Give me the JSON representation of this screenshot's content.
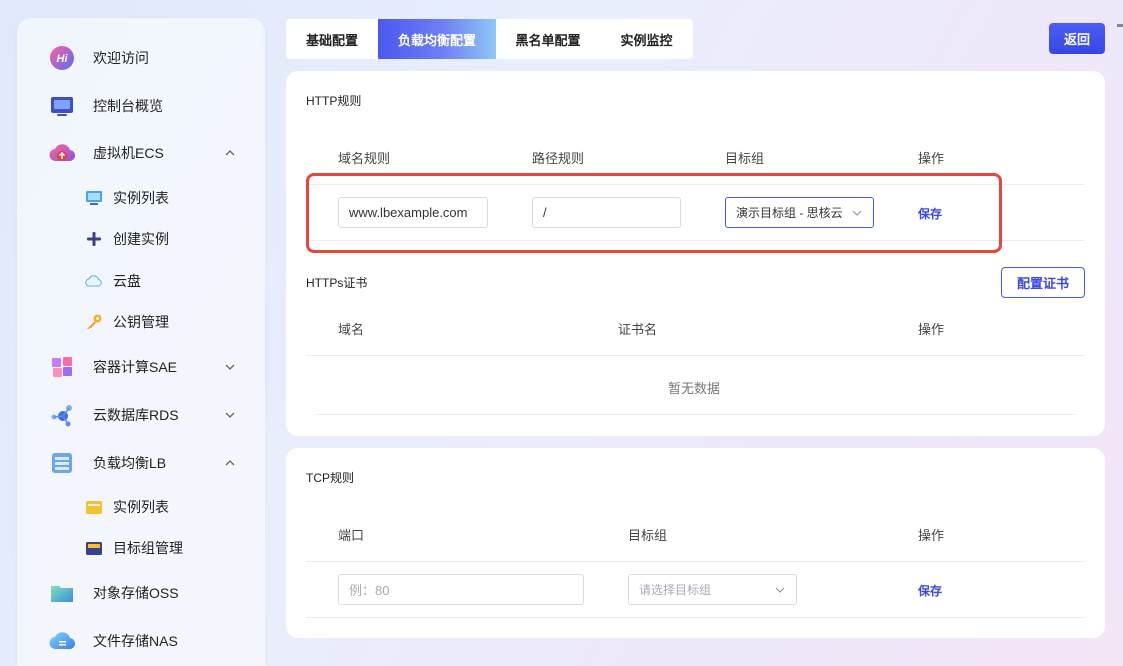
{
  "sidebar": {
    "items": [
      {
        "label": "欢迎访问",
        "icon": "hi-logo-icon"
      },
      {
        "label": "控制台概览",
        "icon": "dashboard-icon"
      },
      {
        "label": "虚拟机ECS",
        "icon": "cloud-upload-icon",
        "expanded": true
      },
      {
        "label": "容器计算SAE",
        "icon": "cubes-icon",
        "expanded": false
      },
      {
        "label": "云数据库RDS",
        "icon": "database-network-icon",
        "expanded": false
      },
      {
        "label": "负载均衡LB",
        "icon": "server-rack-icon",
        "expanded": true
      },
      {
        "label": "对象存储OSS",
        "icon": "folder-icon"
      },
      {
        "label": "文件存储NAS",
        "icon": "cloud-file-icon"
      }
    ],
    "ecs_sub": [
      {
        "label": "实例列表",
        "icon": "monitor-icon"
      },
      {
        "label": "创建实例",
        "icon": "plus-icon"
      },
      {
        "label": "云盘",
        "icon": "cloud-icon"
      },
      {
        "label": "公钥管理",
        "icon": "key-icon"
      }
    ],
    "lb_sub": [
      {
        "label": "实例列表",
        "icon": "folder-list-icon"
      },
      {
        "label": "目标组管理",
        "icon": "toolbox-icon"
      }
    ]
  },
  "tabs": [
    {
      "label": "基础配置",
      "active": false
    },
    {
      "label": "负载均衡配置",
      "active": true
    },
    {
      "label": "黑名单配置",
      "active": false
    },
    {
      "label": "实例监控",
      "active": false
    }
  ],
  "back_label": "返回",
  "http": {
    "title": "HTTP规则",
    "columns": [
      "域名规则",
      "路径规则",
      "目标组",
      "操作"
    ],
    "row": {
      "domain": "www.lbexample.com",
      "path": "/",
      "target_group": "演示目标组 - 思核云",
      "action": "保存"
    }
  },
  "https": {
    "title": "HTTPs证书",
    "config_button": "配置证书",
    "columns": [
      "域名",
      "证书名",
      "操作"
    ],
    "empty_text": "暂无数据"
  },
  "tcp": {
    "title": "TCP规则",
    "columns": [
      "端口",
      "目标组",
      "操作"
    ],
    "row": {
      "port_placeholder": "例：80",
      "target_placeholder": "请选择目标组",
      "action": "保存"
    }
  },
  "colors": {
    "accent": "#4b58f0",
    "highlight": "#e8453c"
  }
}
